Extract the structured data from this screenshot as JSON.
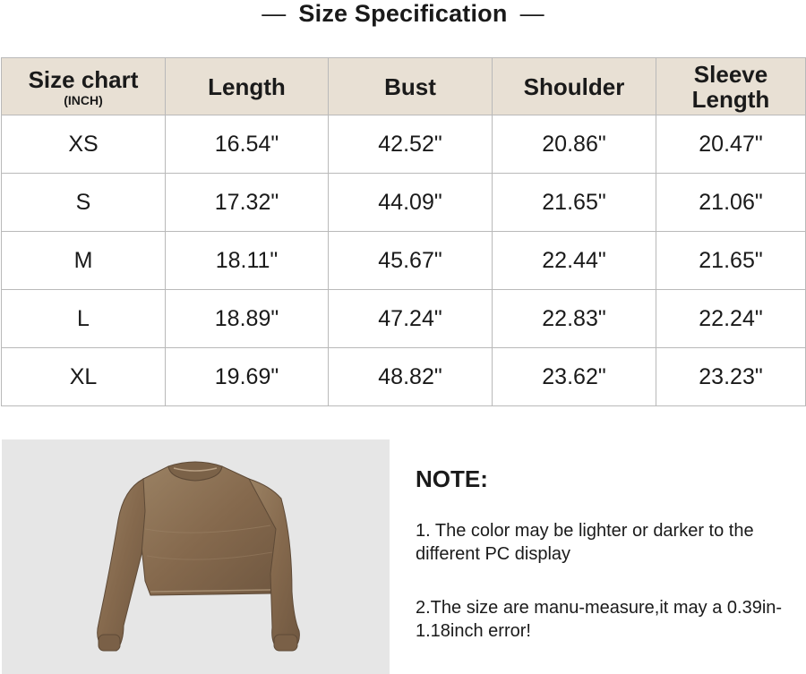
{
  "title": "Size Specification",
  "title_dash": "—",
  "table": {
    "headers": [
      {
        "label": "Size chart",
        "sub": "(INCH)"
      },
      {
        "label": "Length"
      },
      {
        "label": "Bust"
      },
      {
        "label": "Shoulder"
      },
      {
        "label": "Sleeve Length"
      }
    ],
    "rows": [
      [
        "XS",
        "16.54\"",
        "42.52\"",
        "20.86\"",
        "20.47\""
      ],
      [
        "S",
        "17.32\"",
        "44.09\"",
        "21.65\"",
        "21.06\""
      ],
      [
        "M",
        "18.11\"",
        "45.67\"",
        "22.44\"",
        "21.65\""
      ],
      [
        "L",
        "18.89\"",
        "47.24\"",
        "22.83\"",
        "22.24\""
      ],
      [
        "XL",
        "19.69\"",
        "48.82\"",
        "23.62\"",
        "23.23\""
      ]
    ]
  },
  "note": {
    "heading": "NOTE:",
    "items": [
      "1. The color may be lighter or darker to the different PC display",
      "2.The size are manu-measure,it may a 0.39in-1.18inch error!"
    ]
  },
  "colors": {
    "header_bg": "#e8e0d4",
    "border": "#b9b9b9",
    "photo_bg": "#e6e6e6",
    "garment": "#8a7256"
  }
}
